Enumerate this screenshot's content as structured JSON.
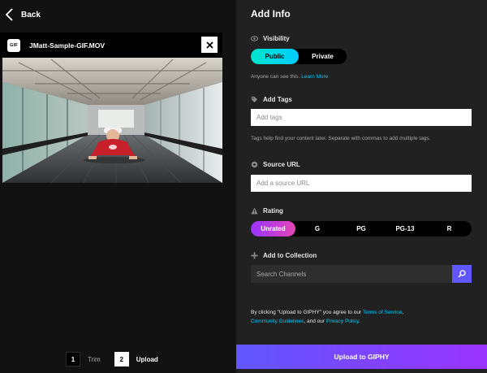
{
  "nav": {
    "back_label": "Back"
  },
  "file": {
    "badge": "GIF",
    "name": "JMatt-Sample-GIF.MOV"
  },
  "steps": [
    {
      "number": "1",
      "label": "Trim"
    },
    {
      "number": "2",
      "label": "Upload"
    }
  ],
  "panel": {
    "title": "Add Info",
    "visibility": {
      "label": "Visibility",
      "options": [
        "Public",
        "Private"
      ],
      "selected": "Public",
      "hint": "Anyone can see this.",
      "hint_link": "Learn More"
    },
    "tags": {
      "label": "Add Tags",
      "placeholder": "Add tags",
      "hint": "Tags help find your content later. Separate with commas to add multiple tags."
    },
    "source": {
      "label": "Source URL",
      "placeholder": "Add a source URL"
    },
    "rating": {
      "label": "Rating",
      "options": [
        "Unrated",
        "G",
        "PG",
        "PG-13",
        "R"
      ],
      "selected": "Unrated"
    },
    "collection": {
      "label": "Add to Collection",
      "placeholder": "Search Channels"
    },
    "terms": {
      "prefix": "By clicking \"Upload to GIPHY\" you agree to our ",
      "tos": "Terms of Service",
      "mid1": ", ",
      "guidelines": "Community Guidelines",
      "mid2": ", and our ",
      "privacy": "Privacy Policy",
      "suffix": "."
    },
    "upload_label": "Upload to GIPHY"
  },
  "colors": {
    "accent_cyan": "#00ccff",
    "accent_purple": "#6157ff",
    "rating_gradient": [
      "#9933ff",
      "#e646b6"
    ]
  },
  "icons": [
    "chevron-left-icon",
    "gif-file-icon",
    "close-icon",
    "eye-icon",
    "tag-icon",
    "link-icon",
    "warning-icon",
    "plus-icon",
    "search-icon"
  ]
}
